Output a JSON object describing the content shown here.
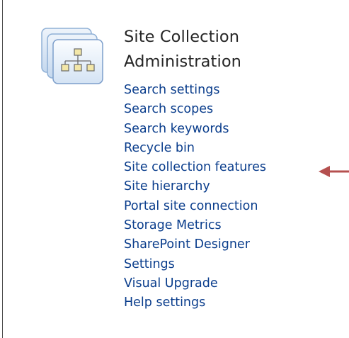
{
  "section": {
    "title_line1": "Site Collection",
    "title_line2": "Administration",
    "icon": "site-hierarchy-icon"
  },
  "links": [
    "Search settings",
    "Search scopes",
    "Search keywords",
    "Recycle bin",
    "Site collection features",
    "Site hierarchy",
    "Portal site connection",
    "Storage Metrics",
    "SharePoint Designer",
    "Settings",
    "Visual Upgrade",
    "Help settings"
  ],
  "annotation": {
    "arrow_target": "Site collection features",
    "arrow_color": "#b5504f"
  },
  "colors": {
    "link": "#0a3d8c",
    "title": "#262626"
  }
}
